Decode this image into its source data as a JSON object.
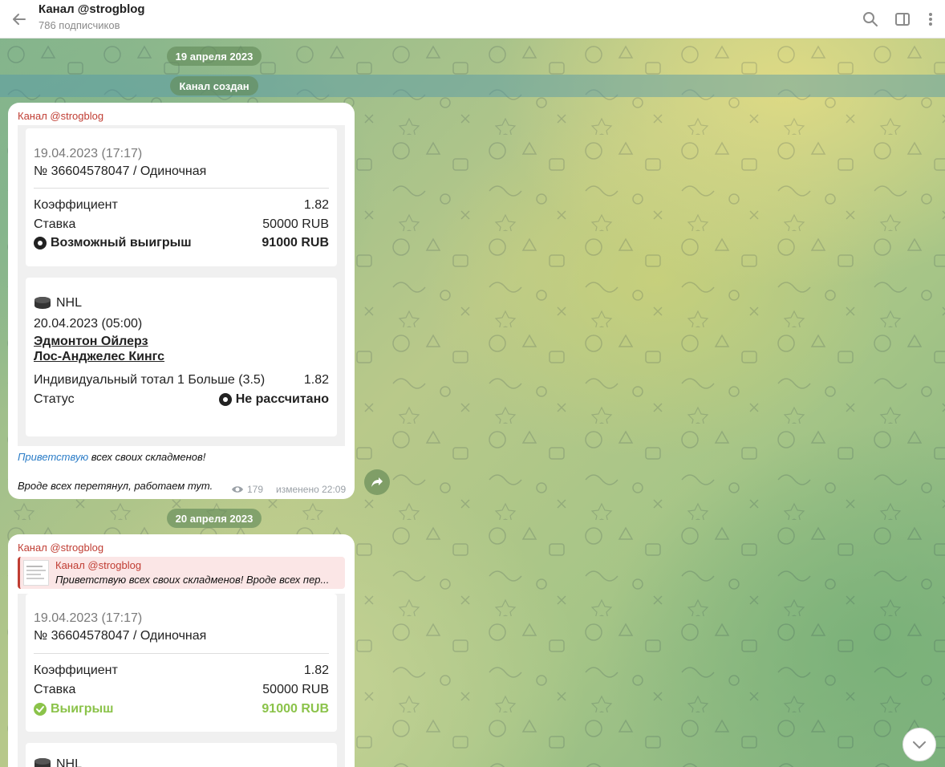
{
  "header": {
    "title": "Канал @strogblog",
    "subtitle": "786 подписчиков",
    "icons": [
      "back-arrow-icon",
      "search-icon",
      "sidebar-toggle-icon",
      "more-vertical-icon"
    ]
  },
  "dates": {
    "first": "19 апреля 2023",
    "service": "Канал создан",
    "second": "20 апреля 2023"
  },
  "post1": {
    "sender": "Канал @strogblog",
    "bet": {
      "datetime": "19.04.2023 (17:17)",
      "number": "№ 36604578047 / Одиночная",
      "coef_label": "Коэффициент",
      "coef_value": "1.82",
      "stake_label": "Ставка",
      "stake_value": "50000 RUB",
      "win_label": "Возможный выигрыш",
      "win_value": "91000 RUB"
    },
    "event": {
      "league": "NHL",
      "datetime": "20.04.2023 (05:00)",
      "team1": "Эдмонтон Ойлерз",
      "team2": "Лос-Анджелес Кингс",
      "market": "Индивидуальный тотал 1 Больше (3.5)",
      "market_coef": "1.82",
      "status_label": "Статус",
      "status_value": "Не рассчитано"
    },
    "caption_link": "Приветствую",
    "caption_rest": " всех своих складменов!",
    "caption_line2": "Вроде всех перетянул, работаем тут.",
    "views": "179",
    "edited": "изменено 22:09"
  },
  "post2": {
    "sender": "Канал @strogblog",
    "reply_name": "Канал @strogblog",
    "reply_text": "Приветствую всех своих складменов!   Вроде всех пер...",
    "bet": {
      "datetime": "19.04.2023 (17:17)",
      "number": "№ 36604578047 / Одиночная",
      "coef_label": "Коэффициент",
      "coef_value": "1.82",
      "stake_label": "Ставка",
      "stake_value": "50000 RUB",
      "win_label": "Выигрыш",
      "win_value": "91000 RUB"
    },
    "event_league": "NHL"
  },
  "colors": {
    "accent_red": "#c03d33",
    "link_blue": "#2a7cc7",
    "win_green": "#8bc34a"
  }
}
